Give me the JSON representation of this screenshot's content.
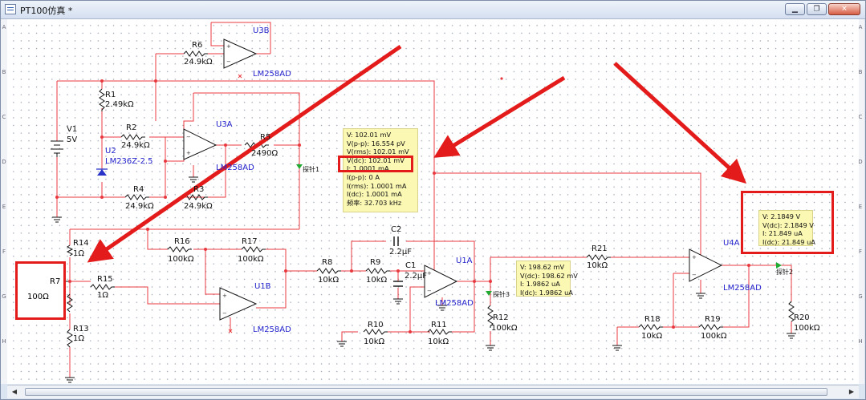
{
  "window": {
    "title": "PT100仿真 *",
    "controls": [
      "minimize",
      "restore",
      "close"
    ]
  },
  "ruler": {
    "rows": [
      "A",
      "B",
      "C",
      "D",
      "E",
      "F",
      "G",
      "H"
    ]
  },
  "components": {
    "V1": {
      "ref": "V1",
      "value": "5V"
    },
    "R1": {
      "ref": "R1",
      "value": "2.49kΩ"
    },
    "R2": {
      "ref": "R2",
      "value": "24.9kΩ"
    },
    "R3": {
      "ref": "R3",
      "value": "24.9kΩ"
    },
    "R4": {
      "ref": "R4",
      "value": "24.9kΩ"
    },
    "R5": {
      "ref": "R5",
      "value": "2490Ω"
    },
    "R6": {
      "ref": "R6",
      "value": "24.9kΩ"
    },
    "R7": {
      "ref": "R7",
      "value": "100Ω"
    },
    "R8": {
      "ref": "R8",
      "value": "10kΩ"
    },
    "R9": {
      "ref": "R9",
      "value": "10kΩ"
    },
    "R10": {
      "ref": "R10",
      "value": "10kΩ"
    },
    "R11": {
      "ref": "R11",
      "value": "10kΩ"
    },
    "R12": {
      "ref": "R12",
      "value": "100kΩ"
    },
    "R13": {
      "ref": "R13",
      "value": "1Ω"
    },
    "R14": {
      "ref": "R14",
      "value": "1Ω"
    },
    "R15": {
      "ref": "R15",
      "value": "1Ω"
    },
    "R16": {
      "ref": "R16",
      "value": "100kΩ"
    },
    "R17": {
      "ref": "R17",
      "value": "100kΩ"
    },
    "R18": {
      "ref": "R18",
      "value": "10kΩ"
    },
    "R19": {
      "ref": "R19",
      "value": "100kΩ"
    },
    "R20": {
      "ref": "R20",
      "value": "100kΩ"
    },
    "R21": {
      "ref": "R21",
      "value": "10kΩ"
    },
    "C1": {
      "ref": "C1",
      "value": "2.2µF"
    },
    "C2": {
      "ref": "C2",
      "value": "2.2µF"
    },
    "U2": {
      "ref": "U2",
      "value": "LM236Z-2.5"
    },
    "U1A": {
      "ref": "U1A",
      "value": "LM258AD"
    },
    "U1B": {
      "ref": "U1B",
      "value": "LM258AD"
    },
    "U3A": {
      "ref": "U3A",
      "value": "LM258AD"
    },
    "U3B": {
      "ref": "U3B",
      "value": "LM258AD"
    },
    "U4A": {
      "ref": "U4A",
      "value": "LM258AD"
    }
  },
  "probes": {
    "probe1": {
      "label": "探针1",
      "lines": [
        "V: 102.01 mV",
        "V(p-p): 16.554 pV",
        "V(rms): 102.01 mV",
        "V(dc): 102.01 mV",
        "I: 1.0001 mA",
        "I(p-p): 0 A",
        "I(rms): 1.0001 mA",
        "I(dc): 1.0001 mA",
        "频率: 32.703 kHz"
      ]
    },
    "probe2": {
      "label": "探针2",
      "lines": [
        "V: 2.1849 V",
        "V(dc): 2.1849 V",
        "I: 21.849 uA",
        "I(dc): 21.849 uA"
      ]
    },
    "probe3": {
      "label": "探针3",
      "lines": [
        "V: 198.62 mV",
        "V(dc): 198.62 mV",
        "I: 1.9862 uA",
        "I(dc): 1.9862 uA"
      ]
    }
  },
  "colors": {
    "wire": "#e8393f",
    "label": "#111111",
    "partname": "#2222cc",
    "highlight": "#e31b1b",
    "probe_bg": "#fbf8b3",
    "probe_marker": "#22aa33"
  }
}
